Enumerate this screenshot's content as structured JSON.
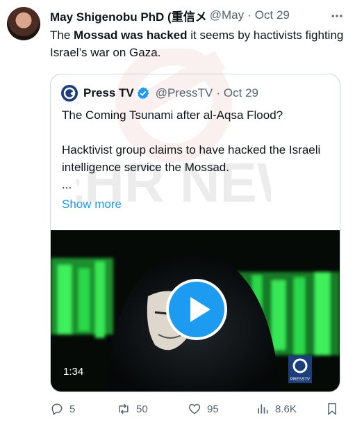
{
  "tweet": {
    "author_name": "May Shigenobu PhD (重信メ",
    "handle": "@May",
    "date": "Oct 29",
    "text_parts": {
      "p1": "The ",
      "b1": "Mossad was hacked",
      "p2": " it seems by hactivists fighting Israel’s war on Gaza."
    }
  },
  "quote": {
    "name": "Press TV",
    "handle": "@PressTV",
    "date": "Oct 29",
    "line1": "The Coming Tsunami after al-Aqsa Flood?",
    "line2": "Hacktivist group claims to have hacked the Israeli intelligence service the Mossad.",
    "ellipsis": "...",
    "show_more": "Show more",
    "video_duration": "1:34",
    "video_logo_text": "PRESSTV"
  },
  "actions": {
    "replies": "5",
    "reposts": "50",
    "likes": "95",
    "views": "8.6K"
  },
  "watermark_text": "MEHR NEWS",
  "colors": {
    "text": "#0f1419",
    "secondary": "#536471",
    "link": "#1d9bf0",
    "border": "#cfd9de",
    "video_green": "#2bd94a"
  }
}
